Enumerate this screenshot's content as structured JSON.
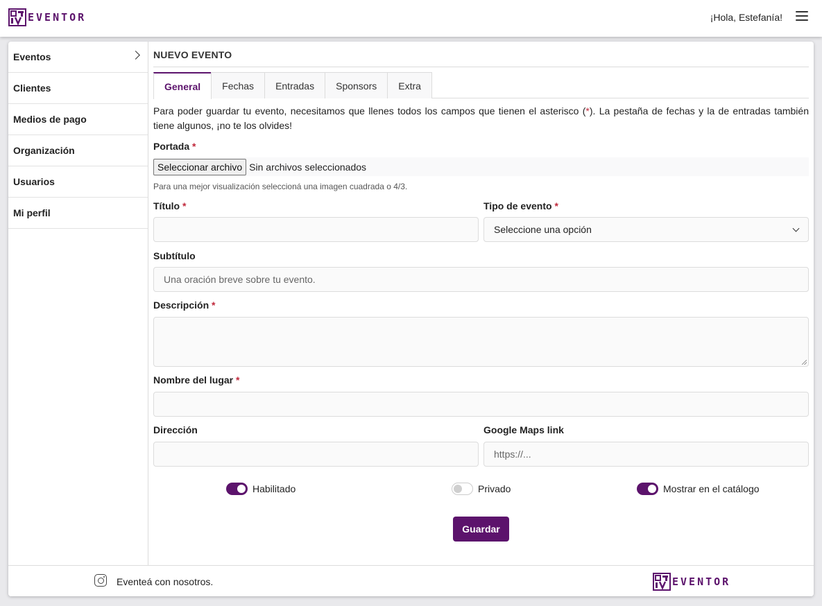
{
  "brand": {
    "name": "EVENTOR",
    "logo_icon": "eventor-logo-icon",
    "color": "#5c136c"
  },
  "header": {
    "greeting": "¡Hola, Estefanía!",
    "menu_icon": "hamburger-menu-icon"
  },
  "sidebar": {
    "items": [
      {
        "label": "Eventos",
        "has_chevron": true
      },
      {
        "label": "Clientes"
      },
      {
        "label": "Medios de pago"
      },
      {
        "label": "Organización"
      },
      {
        "label": "Usuarios"
      },
      {
        "label": "Mi perfil"
      }
    ]
  },
  "main": {
    "title": "NUEVO EVENTO",
    "tabs": [
      {
        "label": "General",
        "active": true
      },
      {
        "label": "Fechas"
      },
      {
        "label": "Entradas"
      },
      {
        "label": "Sponsors"
      },
      {
        "label": "Extra"
      }
    ],
    "intro_before": "Para poder guardar tu evento, necesitamos que llenes todos los campos que tienen el asterisco (",
    "intro_star": "*",
    "intro_after": "). La pestaña de fechas y la de entradas también tiene algunos, ¡no te los olvides!",
    "required_mark": "*",
    "form": {
      "portada_label": "Portada",
      "file_button": "Seleccionar archivo",
      "file_status": "Sin archivos seleccionados",
      "file_hint": "Para una mejor visualización seleccioná una imagen cuadrada o 4/3.",
      "titulo_label": "Título",
      "titulo_value": "",
      "tipo_label": "Tipo de evento",
      "tipo_selected": "Seleccione una opción",
      "subtitulo_label": "Subtítulo",
      "subtitulo_placeholder": "Una oración breve sobre tu evento.",
      "descripcion_label": "Descripción",
      "descripcion_value": "",
      "lugar_label": "Nombre del lugar",
      "lugar_value": "",
      "direccion_label": "Dirección",
      "direccion_value": "",
      "maps_label": "Google Maps link",
      "maps_placeholder": "https://..."
    },
    "toggles": [
      {
        "label": "Habilitado",
        "on": true
      },
      {
        "label": "Privado",
        "on": false
      },
      {
        "label": "Mostrar en el catálogo",
        "on": true
      }
    ],
    "save_label": "Guardar"
  },
  "footer": {
    "icon": "instagram-icon",
    "text": "Eventeá con nosotros."
  }
}
